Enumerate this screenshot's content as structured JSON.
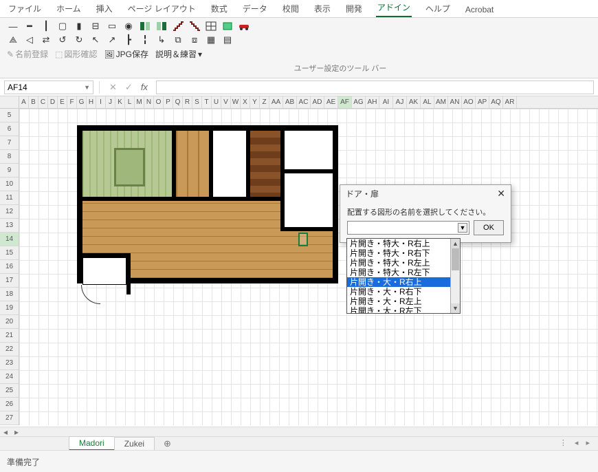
{
  "ribbon": {
    "tabs": [
      "ファイル",
      "ホーム",
      "挿入",
      "ページ レイアウト",
      "数式",
      "データ",
      "校閲",
      "表示",
      "開発",
      "アドイン",
      "ヘルプ",
      "Acrobat"
    ],
    "active_index": 9
  },
  "toolbar": {
    "register_name": "名前登録",
    "shape_check": "図形確認",
    "jpg_save": "JPG保存",
    "explain_practice": "説明＆練習",
    "group_caption": "ユーザー設定のツール バー"
  },
  "namebox": {
    "value": "AF14"
  },
  "columns": [
    "A",
    "B",
    "C",
    "D",
    "E",
    "F",
    "G",
    "H",
    "I",
    "J",
    "K",
    "L",
    "M",
    "N",
    "O",
    "P",
    "Q",
    "R",
    "S",
    "T",
    "U",
    "V",
    "W",
    "X",
    "Y",
    "Z",
    "AA",
    "AB",
    "AC",
    "AD",
    "AE",
    "AF",
    "AG",
    "AH",
    "AI",
    "AJ",
    "AK",
    "AL",
    "AM",
    "AN",
    "AO",
    "AP",
    "AQ",
    "AR"
  ],
  "selected_column_index": 31,
  "rows_start": 5,
  "rows_end": 27,
  "selected_row": 14,
  "sheets": {
    "tabs": [
      "Madori",
      "Zukei"
    ],
    "active_index": 0
  },
  "statusbar": {
    "text": "準備完了"
  },
  "dialog": {
    "title": "ドア・扉",
    "instruction": "配置する図形の名前を選択してください。",
    "combo_value": "",
    "ok_label": "OK",
    "list": [
      "片開き・特大・R右上",
      "片開き・特大・R右下",
      "片開き・特大・R左上",
      "片開き・特大・R左下",
      "片開き・大・R右上",
      "片開き・大・R右下",
      "片開き・大・R左上",
      "片開き・大・R左下"
    ],
    "selected_list_index": 4
  }
}
